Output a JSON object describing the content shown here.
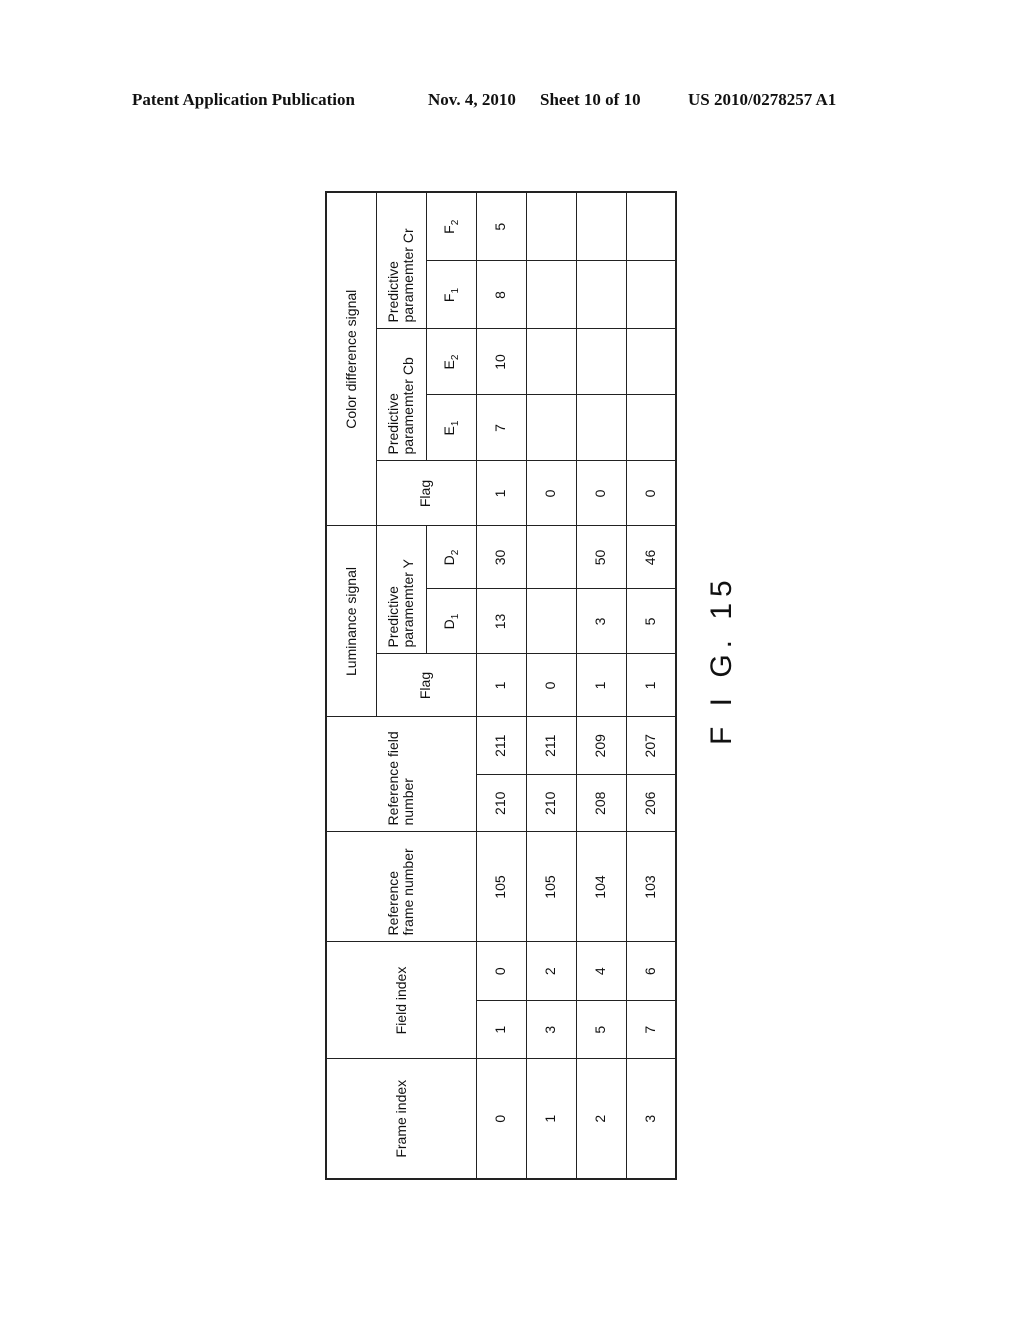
{
  "header": {
    "publication": "Patent Application Publication",
    "date": "Nov. 4, 2010",
    "sheet": "Sheet 10 of 10",
    "number": "US 2010/0278257 A1"
  },
  "figure": {
    "label": "F I G. 15",
    "orientation": "rotated 90° counter-clockwise",
    "table": {
      "headers": {
        "frame_index": "Frame index",
        "field_index": "Field index",
        "ref_frame": "Reference frame number",
        "ref_field": "Reference field number",
        "luminance": "Luminance signal",
        "color_diff": "Color difference signal",
        "flag": "Flag",
        "pred_y": "Predictive paramemter Y",
        "pred_cb": "Predictive paramemter Cb",
        "pred_cr": "Predictive paramemter Cr",
        "d1": "D",
        "d2": "D",
        "e1": "E",
        "e2": "E",
        "f1": "F",
        "f2": "F",
        "sub1": "1",
        "sub2": "2"
      },
      "rows": [
        {
          "frame_index": "0",
          "field_index": [
            "1",
            "0"
          ],
          "ref_frame": "105",
          "ref_field": [
            "210",
            "211"
          ],
          "lum_flag": "1",
          "d1": "13",
          "d2": "30",
          "col_flag": "1",
          "e1": "7",
          "e2": "10",
          "f1": "8",
          "f2": "5"
        },
        {
          "frame_index": "1",
          "field_index": [
            "3",
            "2"
          ],
          "ref_frame": "105",
          "ref_field": [
            "210",
            "211"
          ],
          "lum_flag": "0",
          "d1": "",
          "d2": "",
          "col_flag": "0",
          "e1": "",
          "e2": "",
          "f1": "",
          "f2": ""
        },
        {
          "frame_index": "2",
          "field_index": [
            "5",
            "4"
          ],
          "ref_frame": "104",
          "ref_field": [
            "208",
            "209"
          ],
          "lum_flag": "1",
          "d1": "3",
          "d2": "50",
          "col_flag": "0",
          "e1": "",
          "e2": "",
          "f1": "",
          "f2": ""
        },
        {
          "frame_index": "3",
          "field_index": [
            "7",
            "6"
          ],
          "ref_frame": "103",
          "ref_field": [
            "206",
            "207"
          ],
          "lum_flag": "1",
          "d1": "5",
          "d2": "46",
          "col_flag": "0",
          "e1": "",
          "e2": "",
          "f1": "",
          "f2": ""
        }
      ]
    }
  }
}
